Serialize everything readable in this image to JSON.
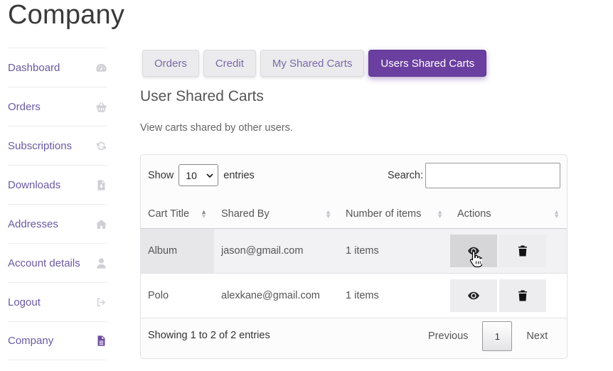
{
  "page": {
    "title": "Company"
  },
  "sidebar": {
    "items": [
      {
        "label": "Dashboard",
        "icon": "dashboard-gauge-icon"
      },
      {
        "label": "Orders",
        "icon": "basket-icon"
      },
      {
        "label": "Subscriptions",
        "icon": "refresh-icon"
      },
      {
        "label": "Downloads",
        "icon": "file-download-icon"
      },
      {
        "label": "Addresses",
        "icon": "home-icon"
      },
      {
        "label": "Account details",
        "icon": "user-icon"
      },
      {
        "label": "Logout",
        "icon": "sign-out-icon"
      },
      {
        "label": "Company",
        "icon": "file-text-icon",
        "active": true
      }
    ]
  },
  "tabs": [
    {
      "label": "Orders"
    },
    {
      "label": "Credit"
    },
    {
      "label": "My Shared Carts"
    },
    {
      "label": "Users Shared Carts",
      "active": true
    }
  ],
  "section": {
    "title": "User Shared Carts",
    "description": "View carts shared by other users."
  },
  "table": {
    "show_label": "Show",
    "entries_value": "10",
    "entries_label": "entries",
    "search_label": "Search:",
    "search_value": "",
    "columns": [
      "Cart Title",
      "Shared By",
      "Number of items",
      "Actions"
    ],
    "rows": [
      {
        "title": "Album",
        "shared_by": "jason@gmail.com",
        "items": "1 items"
      },
      {
        "title": "Polo",
        "shared_by": "alexkane@gmail.com",
        "items": "1 items"
      }
    ],
    "info": "Showing 1 to 2 of 2 entries",
    "pagination": {
      "previous": "Previous",
      "current": "1",
      "next": "Next"
    }
  },
  "colors": {
    "accent": "#6b3fa0",
    "link": "#6b5aa3"
  }
}
